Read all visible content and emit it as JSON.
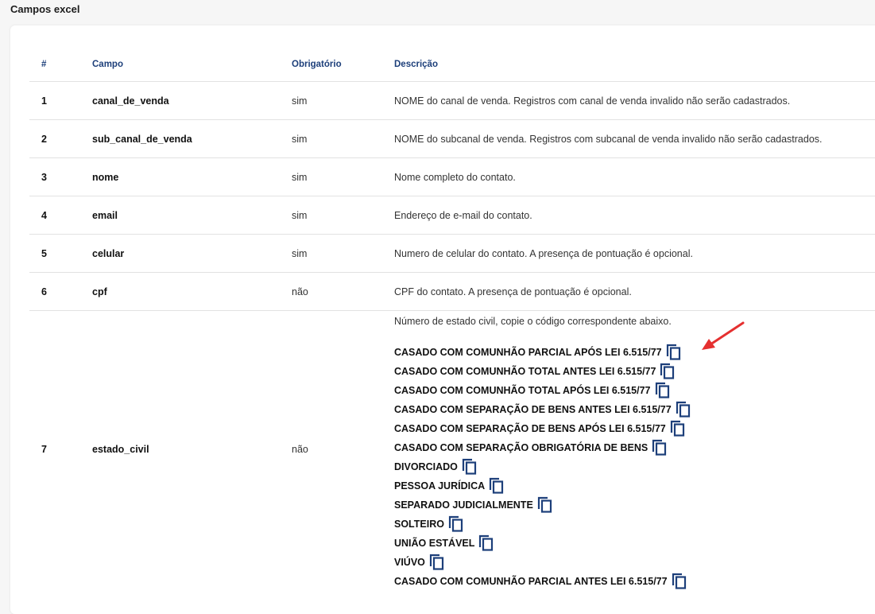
{
  "page": {
    "title": "Campos excel"
  },
  "table": {
    "headers": [
      "#",
      "Campo",
      "Obrigatório",
      "Descrição"
    ],
    "rows": [
      {
        "num": "1",
        "campo": "canal_de_venda",
        "obrigatorio": "sim",
        "descricao": "NOME do canal de venda. Registros com canal de venda invalido não serão cadastrados."
      },
      {
        "num": "2",
        "campo": "sub_canal_de_venda",
        "obrigatorio": "sim",
        "descricao": "NOME do subcanal de venda. Registros com subcanal de venda invalido não serão cadastrados."
      },
      {
        "num": "3",
        "campo": "nome",
        "obrigatorio": "sim",
        "descricao": "Nome completo do contato."
      },
      {
        "num": "4",
        "campo": "email",
        "obrigatorio": "sim",
        "descricao": "Endereço de e-mail do contato."
      },
      {
        "num": "5",
        "campo": "celular",
        "obrigatorio": "sim",
        "descricao": "Numero de celular do contato. A presença de pontuação é opcional."
      },
      {
        "num": "6",
        "campo": "cpf",
        "obrigatorio": "não",
        "descricao": "CPF do contato. A presença de pontuação é opcional."
      }
    ],
    "estado_civil_row": {
      "num": "7",
      "campo": "estado_civil",
      "obrigatorio": "não",
      "descricao": "Número de estado civil, copie o código correspondente abaixo.",
      "options": [
        "CASADO COM COMUNHÃO PARCIAL APÓS LEI 6.515/77",
        "CASADO COM COMUNHÃO TOTAL ANTES LEI 6.515/77",
        "CASADO COM COMUNHÃO TOTAL APÓS LEI 6.515/77",
        "CASADO COM SEPARAÇÃO DE BENS ANTES LEI 6.515/77",
        "CASADO COM SEPARAÇÃO DE BENS APÓS LEI 6.515/77",
        "CASADO COM SEPARAÇÃO OBRIGATÓRIA DE BENS",
        "DIVORCIADO",
        "PESSOA JURÍDICA",
        "SEPARADO JUDICIALMENTE",
        "SOLTEIRO",
        "UNIÃO ESTÁVEL",
        "VIÚVO",
        "CASADO COM COMUNHÃO PARCIAL ANTES LEI 6.515/77"
      ]
    }
  },
  "icons": {
    "copy": "copy-icon",
    "annotation": "red-arrow-icon"
  },
  "colors": {
    "header_text": "#1d3f7a",
    "icon": "#1d3f7a",
    "arrow": "#e53030"
  }
}
